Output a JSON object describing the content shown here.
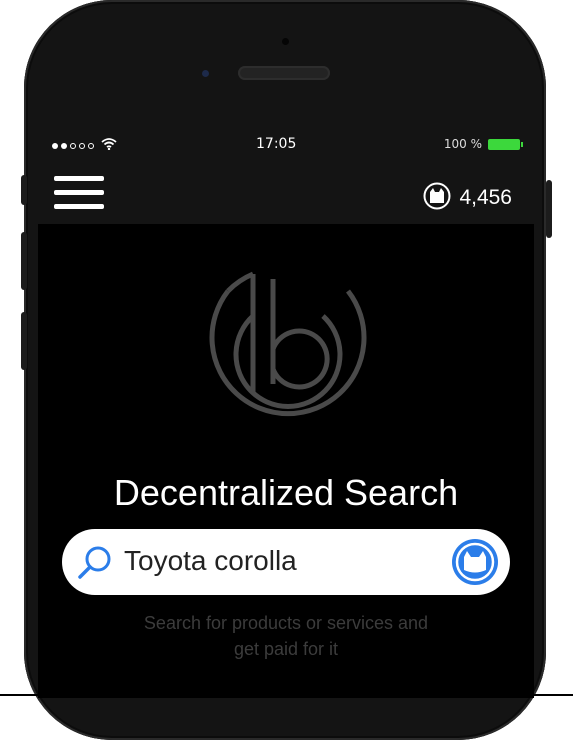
{
  "status_bar": {
    "signal_bars_filled": 2,
    "signal_bars_total": 5,
    "wifi_icon": "wifi-icon",
    "time": "17:05",
    "battery_percent": "100 %",
    "battery_color": "#3cd83c"
  },
  "nav": {
    "menu_icon": "hamburger-icon",
    "token_icon": "cat-coin-icon",
    "token_count": "4,456"
  },
  "hero": {
    "logo_icon": "b-logo-icon",
    "title": "Decentralized Search"
  },
  "search": {
    "search_icon": "search-icon",
    "value": "Toyota corolla",
    "button_icon": "cat-coin-icon",
    "accent_color": "#2b7de9"
  },
  "caption": {
    "line1": "Search for products or services and",
    "line2": "get paid for it"
  }
}
